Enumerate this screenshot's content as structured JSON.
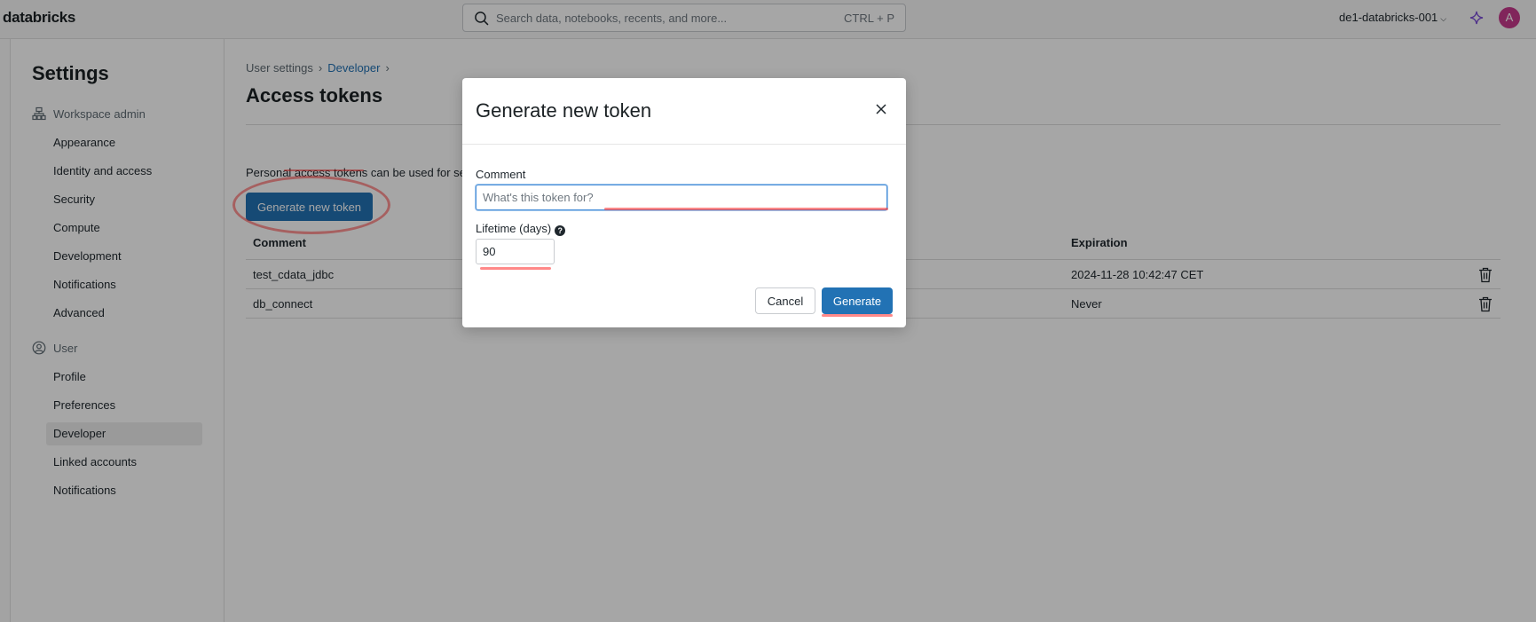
{
  "topbar": {
    "logo": "databricks",
    "search_placeholder": "Search data, notebooks, recents, and more...",
    "search_shortcut": "CTRL + P",
    "workspace": "de1-databricks-001",
    "avatar_letter": "A"
  },
  "settings_nav": {
    "title": "Settings",
    "workspace_admin_label": "Workspace admin",
    "workspace_admin_items": [
      "Appearance",
      "Identity and access",
      "Security",
      "Compute",
      "Development",
      "Notifications",
      "Advanced"
    ],
    "user_label": "User",
    "user_items": [
      "Profile",
      "Preferences",
      "Developer",
      "Linked accounts",
      "Notifications"
    ],
    "active_item": "Developer"
  },
  "main": {
    "breadcrumb": [
      "User settings",
      "Developer"
    ],
    "title": "Access tokens",
    "description": "Personal access tokens can be used for se",
    "generate_button": "Generate new token",
    "table": {
      "headers": [
        "Comment",
        "Expiration"
      ],
      "rows": [
        {
          "comment": "test_cdata_jdbc",
          "expiration": "2024-11-28 10:42:47 CET"
        },
        {
          "comment": "db_connect",
          "expiration": "Never"
        }
      ]
    }
  },
  "modal": {
    "title": "Generate new token",
    "comment_label": "Comment",
    "comment_placeholder": "What's this token for?",
    "comment_value": "",
    "lifetime_label": "Lifetime (days)",
    "lifetime_value": "90",
    "cancel_label": "Cancel",
    "generate_label": "Generate"
  },
  "colors": {
    "primary": "#2272b4",
    "avatar": "#c73a8c",
    "annotation": "#ff3c3c"
  }
}
